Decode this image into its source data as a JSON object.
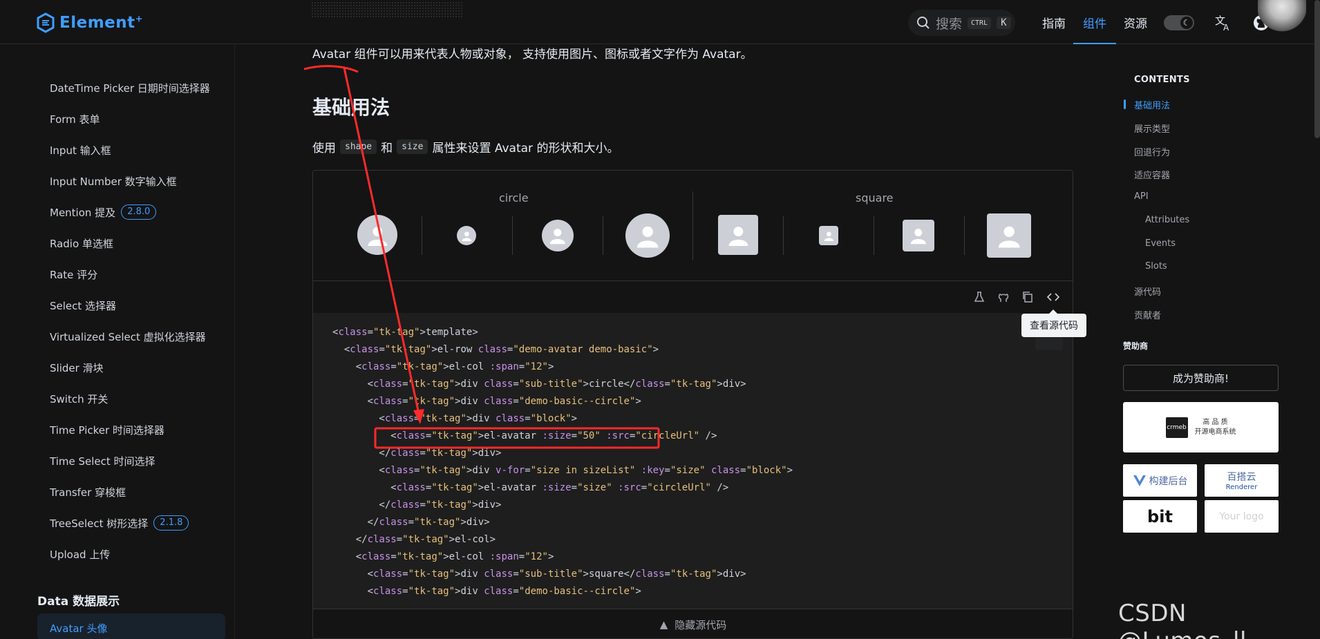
{
  "header": {
    "logo_text": "Element",
    "logo_plus": "+",
    "search_placeholder": "搜索",
    "kbd_ctrl": "CTRL",
    "kbd_k": "K",
    "nav": [
      "指南",
      "组件",
      "资源"
    ],
    "active_nav": "组件"
  },
  "sidebar": {
    "items": [
      {
        "label": "DateTime Picker 日期时间选择器"
      },
      {
        "label": "Form 表单"
      },
      {
        "label": "Input 输入框"
      },
      {
        "label": "Input Number 数字输入框"
      },
      {
        "label": "Mention 提及",
        "badge": "2.8.0"
      },
      {
        "label": "Radio 单选框"
      },
      {
        "label": "Rate 评分"
      },
      {
        "label": "Select 选择器"
      },
      {
        "label": "Virtualized Select 虚拟化选择器"
      },
      {
        "label": "Slider 滑块"
      },
      {
        "label": "Switch 开关"
      },
      {
        "label": "Time Picker 时间选择器"
      },
      {
        "label": "Time Select 时间选择"
      },
      {
        "label": "Transfer 穿梭框"
      },
      {
        "label": "TreeSelect 树形选择",
        "badge": "2.1.8"
      },
      {
        "label": "Upload 上传"
      }
    ],
    "group": "Data 数据展示",
    "active_item": "Avatar 头像"
  },
  "main": {
    "intro": "Avatar 组件可以用来代表人物或对象， 支持使用图片、图标或者文字作为 Avatar。",
    "heading": "基础用法",
    "desc_before": "使用",
    "desc_code1": "shape",
    "desc_and": "和",
    "desc_code2": "size",
    "desc_after": "属性来设置 Avatar 的形状和大小。",
    "demo": {
      "col_circle": "circle",
      "col_square": "square"
    },
    "tooltip": "查看源代码",
    "hide_source": "隐藏源代码"
  },
  "code_lines": [
    "<template>",
    "  <el-row class=\"demo-avatar demo-basic\">",
    "    <el-col :span=\"12\">",
    "      <div class=\"sub-title\">circle</div>",
    "      <div class=\"demo-basic--circle\">",
    "        <div class=\"block\">",
    "          <el-avatar :size=\"50\" :src=\"circleUrl\" />",
    "        </div>",
    "        <div v-for=\"size in sizeList\" :key=\"size\" class=\"block\">",
    "          <el-avatar :size=\"size\" :src=\"circleUrl\" />",
    "        </div>",
    "      </div>",
    "    </el-col>",
    "    <el-col :span=\"12\">",
    "      <div class=\"sub-title\">square</div>",
    "      <div class=\"demo-basic--circle\">"
  ],
  "toc": {
    "title": "CONTENTS",
    "items": [
      {
        "label": "基础用法",
        "active": true
      },
      {
        "label": "展示类型"
      },
      {
        "label": "回退行为"
      },
      {
        "label": "适应容器"
      },
      {
        "label": "API"
      },
      {
        "label": "Attributes",
        "sub": true
      },
      {
        "label": "Events",
        "sub": true
      },
      {
        "label": "Slots",
        "sub": true
      },
      {
        "label": "源代码"
      },
      {
        "label": "贡献者"
      }
    ],
    "sponsor_title": "赞助商",
    "sponsor_button": "成为赞助商!",
    "sponsor_crmeb_line1": "高 品 质",
    "sponsor_crmeb_line2": "开源电商系统",
    "sponsor_crmeb_logo": "crmeb",
    "sponsor_vue": "构建后台",
    "sponsor_renderer": "百搭云",
    "sponsor_renderer_sub": "Renderer",
    "sponsor_bit": "bit",
    "sponsor_yourlogo": "Your logo"
  },
  "watermark": "CSDN @Lumos_ll",
  "colors": {
    "accent": "#409eff",
    "annotation": "#ff2a2a",
    "background": "#141414"
  }
}
